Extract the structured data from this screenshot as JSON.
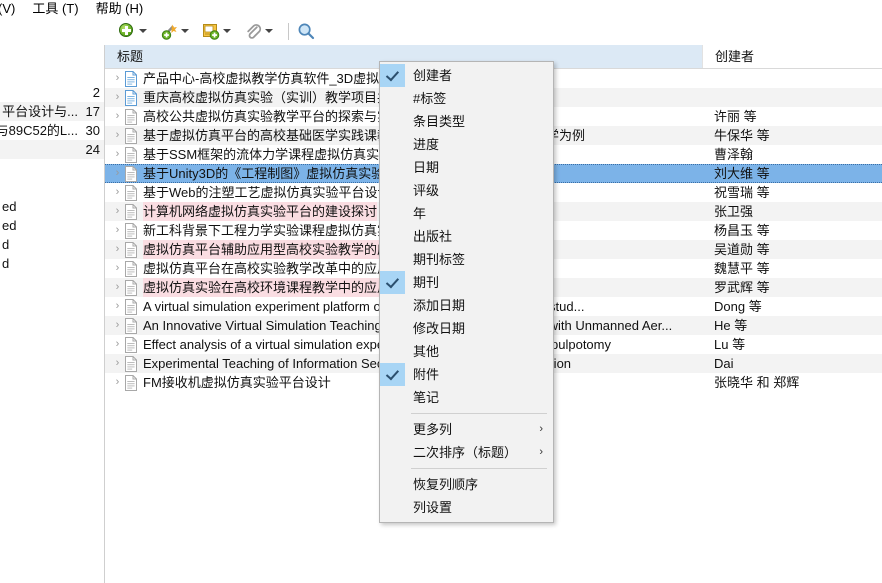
{
  "menubar": {
    "items": [
      {
        "label": "(V)"
      },
      {
        "label": "工具 (T)"
      },
      {
        "label": "帮助 (H)"
      }
    ]
  },
  "toolbar": {
    "new_item_label": "新建条目",
    "add_by_identifier_label": "通过标识符添加条目",
    "new_note_label": "新建笔记",
    "add_attachment_label": "添加附件",
    "advanced_search_label": "高级检索"
  },
  "left_panel": {
    "rows": [
      {
        "fragment": "",
        "text": "",
        "num": ""
      },
      {
        "fragment": "",
        "text": "",
        "num": ""
      },
      {
        "fragment": "",
        "text": "",
        "num": "2"
      },
      {
        "fragment": "",
        "text": "平台设计与...",
        "num": "17"
      },
      {
        "fragment": "",
        "text": "与89C52的L...",
        "num": "30"
      },
      {
        "fragment": "",
        "text": "",
        "num": "24"
      },
      {
        "fragment": "",
        "text": "",
        "num": ""
      },
      {
        "fragment": "",
        "text": "",
        "num": ""
      },
      {
        "fragment": "ed",
        "text": "",
        "num": ""
      },
      {
        "fragment": "ed",
        "text": "",
        "num": ""
      },
      {
        "fragment": "d",
        "text": "",
        "num": ""
      },
      {
        "fragment": "d",
        "text": "",
        "num": ""
      }
    ]
  },
  "items_tree": {
    "columns": [
      {
        "key": "title",
        "label": "标题",
        "sorted": true
      },
      {
        "key": "creator",
        "label": "创建者",
        "sorted": false
      }
    ],
    "rows": [
      {
        "title": "产品中心-高校虚拟教学仿真软件_3D虚拟实",
        "creator": "",
        "icon": "webpage",
        "highlight": false,
        "selected": false
      },
      {
        "title": "重庆高校虚拟仿真实验（实训）教学项目共",
        "creator": "",
        "icon": "webpage",
        "highlight": false,
        "selected": false
      },
      {
        "title": "高校公共虚拟仿真实验教学平台的探索与实",
        "creator": "许丽 等",
        "icon": "journal",
        "highlight": false,
        "selected": false
      },
      {
        "title": "基于虚拟仿真平台的高校基础医学实践课教学改革——以口腔组织病理学为例",
        "creator": "牛保华 等",
        "icon": "journal",
        "highlight": false,
        "selected": false
      },
      {
        "title": "基于SSM框架的流体力学课程虚拟仿真实验",
        "creator": "曹泽翰",
        "icon": "journal",
        "highlight": false,
        "selected": false
      },
      {
        "title": "基于Unity3D的《工程制图》虚拟仿真实验",
        "creator": "刘大维 等",
        "icon": "journal",
        "highlight": false,
        "selected": true
      },
      {
        "title": "基于Web的注塑工艺虚拟仿真实验平台设计",
        "creator": "祝雪瑞 等",
        "icon": "journal",
        "highlight": false,
        "selected": false
      },
      {
        "title": "计算机网络虚拟仿真实验平台的建设探讨",
        "creator": "张卫强",
        "icon": "journal",
        "highlight": true,
        "selected": false
      },
      {
        "title": "新工科背景下工程力学实验课程虚拟仿真实",
        "creator": "杨昌玉 等",
        "icon": "journal",
        "highlight": false,
        "selected": false
      },
      {
        "title": "虚拟仿真平台辅助应用型高校实验教学的应",
        "creator": "吴道勋 等",
        "icon": "journal",
        "highlight": true,
        "selected": false
      },
      {
        "title": "虚拟仿真平台在高校实验教学改革中的应用",
        "creator": "魏慧平 等",
        "icon": "journal",
        "highlight": false,
        "selected": false
      },
      {
        "title": "虚拟仿真实验在高校环境课程教学中的应用",
        "creator": "罗武辉 等",
        "icon": "journal",
        "highlight": true,
        "selected": false
      },
      {
        "title": "A virtual simulation experiment platform of communication system and stud...",
        "creator": "Dong 等",
        "icon": "journal",
        "highlight": false,
        "selected": false
      },
      {
        "title": "An Innovative Virtual Simulation Teaching Platform on Digital Mapping with Unmanned Aer...",
        "creator": "He 等",
        "icon": "journal",
        "highlight": false,
        "selected": false
      },
      {
        "title": "Effect analysis of a virtual simulation experimental platform in teaching pulpotomy",
        "creator": "Lu 等",
        "icon": "journal",
        "highlight": false,
        "selected": false
      },
      {
        "title": "Experimental Teaching of Information Security Based on Virtual Simulation",
        "creator": "Dai",
        "icon": "journal",
        "highlight": false,
        "selected": false
      },
      {
        "title": "FM接收机虚拟仿真实验平台设计",
        "creator": "张晓华 和 郑辉",
        "icon": "journal",
        "highlight": false,
        "selected": false
      }
    ]
  },
  "context_menu": {
    "items": [
      {
        "label": "创建者",
        "checked": true,
        "type": "check"
      },
      {
        "label": "#标签",
        "checked": false,
        "type": "check"
      },
      {
        "label": "条目类型",
        "checked": false,
        "type": "check"
      },
      {
        "label": "进度",
        "checked": false,
        "type": "check"
      },
      {
        "label": "日期",
        "checked": false,
        "type": "check"
      },
      {
        "label": "评级",
        "checked": false,
        "type": "check"
      },
      {
        "label": "年",
        "checked": false,
        "type": "check"
      },
      {
        "label": "出版社",
        "checked": false,
        "type": "check"
      },
      {
        "label": "期刊标签",
        "checked": false,
        "type": "check"
      },
      {
        "label": "期刊",
        "checked": true,
        "type": "check"
      },
      {
        "label": "添加日期",
        "checked": false,
        "type": "check"
      },
      {
        "label": "修改日期",
        "checked": false,
        "type": "check"
      },
      {
        "label": "其他",
        "checked": false,
        "type": "check"
      },
      {
        "label": "附件",
        "checked": true,
        "type": "check"
      },
      {
        "label": "笔记",
        "checked": false,
        "type": "check"
      },
      {
        "type": "separator"
      },
      {
        "label": "更多列",
        "type": "submenu",
        "arrow": "›"
      },
      {
        "label": "二次排序（标题）",
        "type": "submenu",
        "arrow": "›"
      },
      {
        "type": "separator"
      },
      {
        "label": "恢复列顺序",
        "type": "command"
      },
      {
        "label": "列设置",
        "type": "command"
      }
    ]
  },
  "colors": {
    "selection_blue": "#7cb3e8",
    "header_sorted": "#dce9f5",
    "highlight_pink": "#fadde2",
    "row_alt": "#f3f3f3",
    "menu_bg": "#f2f2f2",
    "check_bg": "#a8d5f5"
  }
}
